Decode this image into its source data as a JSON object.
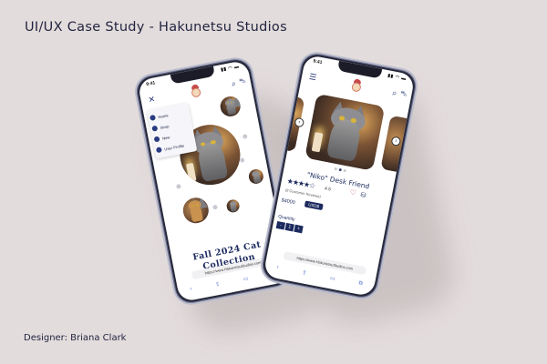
{
  "page": {
    "title": "UI/UX Case Study - Hakunetsu Studios",
    "designer": "Designer: Briana Clark"
  },
  "phone_left": {
    "status_time": "9:41",
    "status_icons": "▮▮ ◠ ▬",
    "menu_items": [
      {
        "label": "Home",
        "icon": "home-icon"
      },
      {
        "label": "Shop",
        "icon": "shop-icon"
      },
      {
        "label": "New",
        "icon": "new-icon"
      },
      {
        "label": "User Profile",
        "icon": "user-icon"
      }
    ],
    "collection_title_line1": "Fall 2024 Cat",
    "collection_title_line2": "Collection",
    "url": "https://www.HakunetsuStudios.com",
    "close_glyph": "✕",
    "search_glyph": "⌕",
    "cart_glyph": "🛒"
  },
  "phone_right": {
    "status_time": "9:41",
    "status_icons": "▮▮ ◠ ▬",
    "menu_glyph": "☰",
    "product_title": "\"Niko\" Desk Friend",
    "stars": "★★★★☆",
    "rating": "4.5",
    "reviews": "(8 Customer Reviews)",
    "price": "$4000",
    "currency": "USD$",
    "quantity_label": "Quantity",
    "qty_minus": "-",
    "qty_value": "1",
    "qty_plus": "+",
    "url": "https://www.HakunetsuStudios.com",
    "heart_glyph": "♡",
    "bag_glyph": "⛁",
    "prev_glyph": "‹",
    "next_glyph": "›"
  },
  "colors": {
    "background": "#e3dcdc",
    "navy": "#1c2a5e",
    "accent_red": "#d0455b"
  }
}
